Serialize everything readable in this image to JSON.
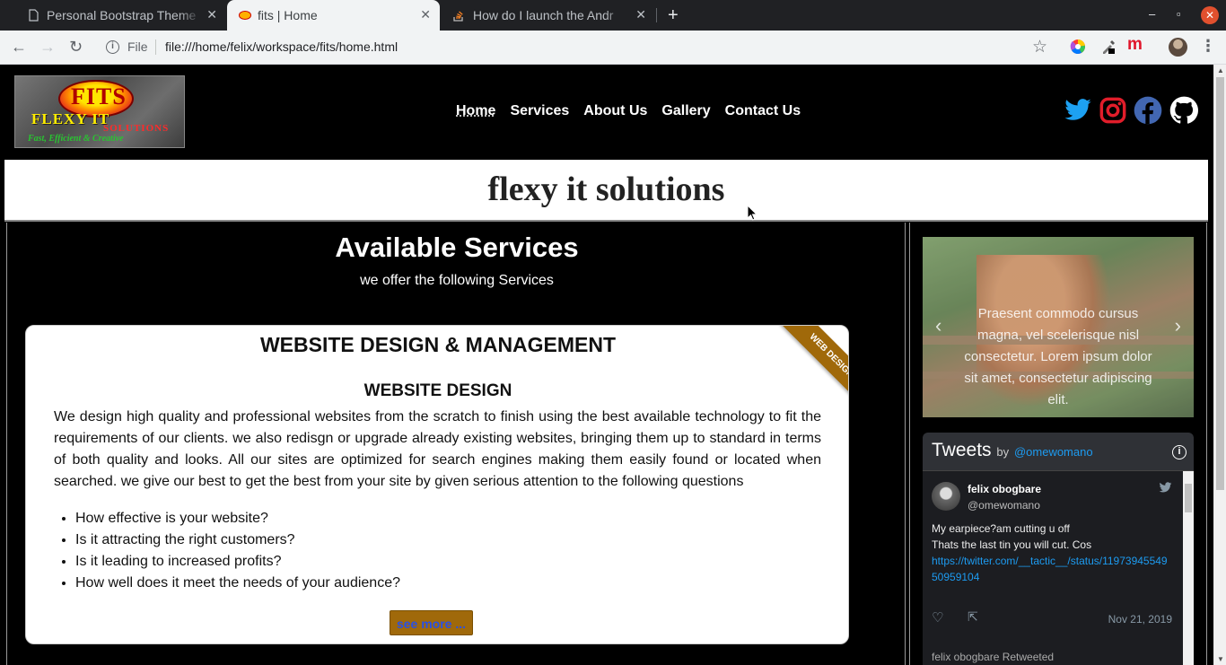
{
  "browser": {
    "tabs": [
      {
        "title": "Personal Bootstrap Theme",
        "active": false
      },
      {
        "title": "fits | Home",
        "active": true
      },
      {
        "title": "How do I launch the Andr",
        "active": false
      }
    ],
    "new_tab": "+",
    "url_scheme_label": "File",
    "url": "file:///home/felix/workspace/fits/home.html",
    "controls": {
      "minimize": "–",
      "maximize": "▫",
      "close": "✕"
    }
  },
  "site": {
    "logo": {
      "mark": "FITS",
      "name": "FLEXY IT",
      "sub": "SOLUTIONS",
      "tagline": "Fast, Efficient & Creative"
    },
    "nav": [
      {
        "label": "Home",
        "active": true
      },
      {
        "label": "Services",
        "active": false
      },
      {
        "label": "About Us",
        "active": false
      },
      {
        "label": "Gallery",
        "active": false
      },
      {
        "label": "Contact Us",
        "active": false
      }
    ],
    "social": [
      "twitter-icon",
      "instagram-icon",
      "facebook-icon",
      "github-icon"
    ],
    "colors": {
      "twitter": "#1da1f2",
      "instagram": "#e11d2a",
      "facebook": "#4267b2",
      "github": "#ffffff",
      "accent": "#a0690a"
    }
  },
  "hero": {
    "title": "flexy it solutions"
  },
  "services": {
    "title": "Available Services",
    "subtitle": "we offer the following Services",
    "card": {
      "ribbon": "WEB DESIGN",
      "title": "WEBSITE DESIGN & MANAGEMENT",
      "subtitle": "WEBSITE DESIGN",
      "text": "We design high quality and professional websites from the scratch to finish using the best available technology to fit the requirements of our clients. we also redisgn or upgrade already existing websites, bringing them up to standard in terms of both quality and looks. All our sites are optimized for search engines making them easily found or located when searched. we give our best to get the best from your site by given serious attention to the following questions",
      "questions": [
        "How effective is your website?",
        "Is it attracting the right customers?",
        "Is it leading to increased profits?",
        "How well does it meet the needs of your audience?"
      ],
      "button": "see more ..."
    }
  },
  "carousel": {
    "caption": "Praesent commodo cursus magna, vel scelerisque nisl consectetur. Lorem ipsum dolor sit amet, consectetur adipiscing elit.",
    "prev": "‹",
    "next": "›"
  },
  "tweets": {
    "title": "Tweets",
    "by": "by",
    "handle": "@omewomano",
    "tweet": {
      "name": "felix obogbare",
      "handle": "@omewomano",
      "line1": "My earpiece?am cutting u off",
      "line2": "Thats the last tin you will cut. Cos",
      "link": "https://twitter.com/__tactic__/status/1197394554950959104",
      "date": "Nov 21, 2019"
    },
    "retweet_label": "felix obogbare Retweeted"
  }
}
